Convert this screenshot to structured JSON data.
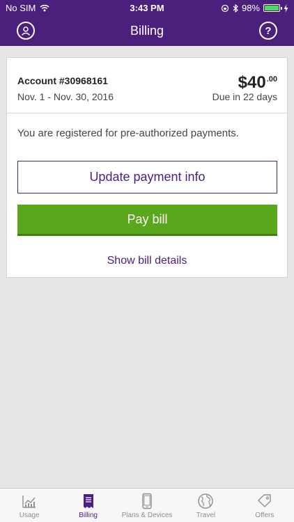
{
  "status_bar": {
    "carrier": "No SIM",
    "time": "3:43 PM",
    "battery_percent": "98%",
    "battery_level": 0.98
  },
  "nav": {
    "title": "Billing",
    "help_label": "?"
  },
  "account": {
    "number": "Account #30968161",
    "period": "Nov. 1 - Nov. 30, 2016",
    "amount_dollars": "$40",
    "amount_cents": ".00",
    "due": "Due in 22 days"
  },
  "billing": {
    "preauth_text": "You are registered for pre-authorized payments.",
    "update_label": "Update payment info",
    "pay_label": "Pay bill",
    "details_label": "Show bill details"
  },
  "tabs": [
    {
      "label": "Usage",
      "icon": "usage-chart-icon",
      "active": false
    },
    {
      "label": "Billing",
      "icon": "billing-document-icon",
      "active": true
    },
    {
      "label": "Plans & Devices",
      "icon": "phone-icon",
      "active": false
    },
    {
      "label": "Travel",
      "icon": "globe-icon",
      "active": false
    },
    {
      "label": "Offers",
      "icon": "tag-icon",
      "active": false
    }
  ],
  "colors": {
    "brand_purple": "#4b1f7c",
    "pay_green": "#5aa61c",
    "battery_green": "#4cd964"
  }
}
